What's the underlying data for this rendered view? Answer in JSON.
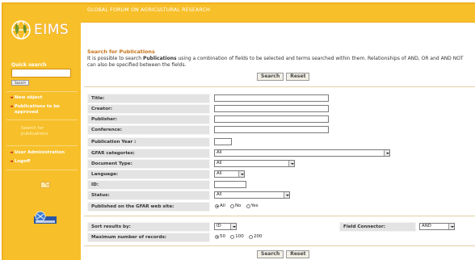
{
  "header": {
    "title": "GLOBAL FORUM ON AGRICULTURAL RESEARCH"
  },
  "logo": {
    "text": "EIMS"
  },
  "sidebar": {
    "quick_search_label": "Quick search",
    "quick_search_button": "Search",
    "items": [
      {
        "label": "New object"
      },
      {
        "label": "Publications to be approved"
      },
      {
        "label": "Search for publications"
      },
      {
        "label": "User Administration"
      },
      {
        "label": "Logoff"
      }
    ]
  },
  "main": {
    "section_title": "Search for Publications",
    "intro_pre": "It is possible to search ",
    "intro_bold": "Publications",
    "intro_post": " using a combination of fields to be selected and terms searched within them. Relationships of AND, OR and AND NOT can also be specified between the fields.",
    "search_label": "Search",
    "reset_label": "Reset"
  },
  "form": {
    "title_label": "Title:",
    "creator_label": "Creator:",
    "publisher_label": "Publisher:",
    "conference_label": "Conference:",
    "year_label": "Publication Year :",
    "categories_label": "GFAR categories:",
    "categories_value": "All",
    "doctype_label": "Document Type:",
    "doctype_value": "All",
    "language_label": "Language:",
    "language_value": "All",
    "id_label": "ID:",
    "status_label": "Status:",
    "status_value": "All",
    "published_label": "Published on the GFAR web site:",
    "published_options": [
      "All",
      "No",
      "Yes"
    ]
  },
  "options": {
    "sort_label": "Sort results by:",
    "sort_value": "ID",
    "connector_label": "Field Connector:",
    "connector_value": "AND",
    "max_label": "Maximum number of records:",
    "max_options": [
      "50",
      "100",
      "200"
    ]
  },
  "colors": {
    "sidebar": "#f7bf2a",
    "title": "#c8731a",
    "bullet": "#c12020"
  }
}
